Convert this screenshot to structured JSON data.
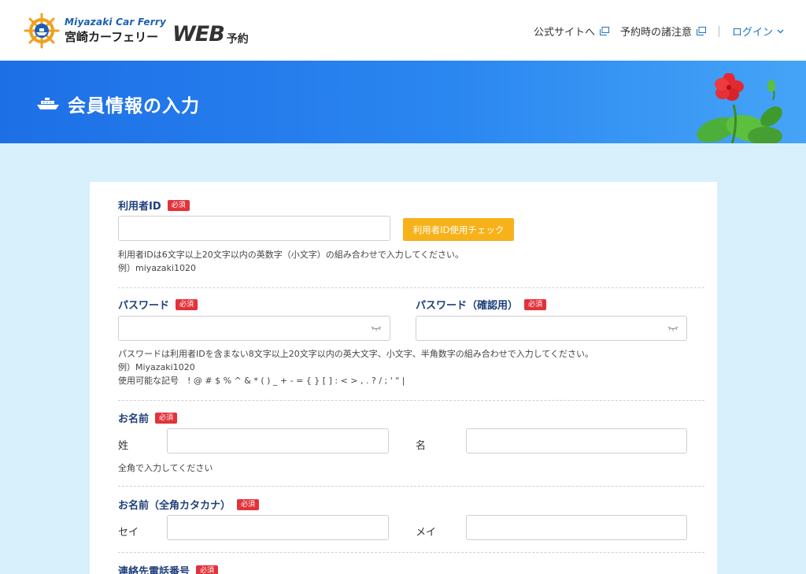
{
  "header": {
    "logo_en": "Miyazaki Car Ferry",
    "logo_jp": "宮崎カーフェリー",
    "logo_web": "WEB",
    "logo_yoyaku": "予約",
    "nav": {
      "official_site": "公式サイトへ",
      "notes": "予約時の諸注意",
      "login": "ログイン"
    },
    "icons": [
      "external-link-icon",
      "chevron-down-icon"
    ]
  },
  "banner": {
    "title": "会員情報の入力",
    "icon": "ship-icon"
  },
  "form": {
    "required_badge": "必須",
    "user_id": {
      "label": "利用者ID",
      "value": "",
      "check_button": "利用者ID使用チェック",
      "help_line1": "利用者IDは6文字以上20文字以内の英数字（小文字）の組み合わせで入力してください。",
      "help_line2": "例）miyazaki1020"
    },
    "password": {
      "label": "パスワード",
      "value": "",
      "confirm_label": "パスワード（確認用）",
      "confirm_value": "",
      "help_line1": "パスワードは利用者IDを含まない8文字以上20文字以内の英大文字、小文字、半角数字の組み合わせで入力してください。",
      "help_line2": "例）Miyazaki1020",
      "help_line3": "使用可能な記号　! @ # $ % ^ & * ( ) _ + - = { } [ ] : < > , . ? / ; ' \" |"
    },
    "name": {
      "label": "お名前",
      "sei_label": "姓",
      "mei_label": "名",
      "sei_value": "",
      "mei_value": "",
      "help": "全角で入力してください"
    },
    "name_kana": {
      "label": "お名前（全角カタカナ）",
      "sei_label": "セイ",
      "mei_label": "メイ",
      "sei_value": "",
      "mei_value": ""
    },
    "phone": {
      "label": "連絡先電話番号"
    }
  },
  "colors": {
    "banner_start": "#1d6fe6",
    "banner_end": "#45a4f7",
    "page_bg": "#d7f0fc",
    "label_color": "#1f3f7a",
    "required_badge": "#e2323a",
    "check_button": "#f7b21a",
    "login_link": "#1a73c8"
  }
}
